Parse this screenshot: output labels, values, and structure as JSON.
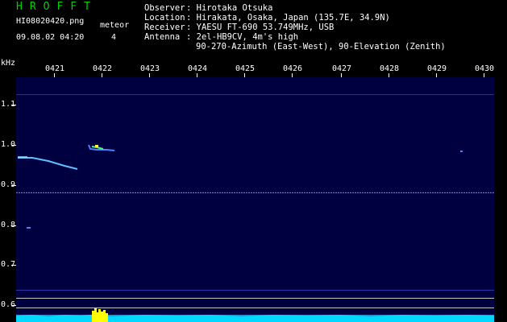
{
  "app_title": "HROFFT",
  "file_name": "HI08020420.png",
  "type_label": "meteor",
  "timestamp": "09.08.02 04:20",
  "count": "4",
  "station": {
    "observer_key": "Observer",
    "observer": "Hirotaka Otsuka",
    "location_key": "Location",
    "location": "Hirakata, Osaka, Japan (135.7E, 34.9N)",
    "receiver_key": "Receiver",
    "receiver": "YAESU FT-690 53.749MHz, USB",
    "antenna_key": "Antenna",
    "antenna_line1": "2el-HB9CV, 4m's high",
    "antenna_line2": "90-270-Azimuth (East-West), 90-Elevation (Zenith)"
  },
  "y_unit": "kHz",
  "x_ticks": [
    "0421",
    "0422",
    "0423",
    "0424",
    "0425",
    "0426",
    "0427",
    "0428",
    "0429",
    "0430"
  ],
  "y_ticks": [
    "1.1",
    "1.0",
    "0.9",
    "0.8",
    "0.7",
    "0.6"
  ],
  "colors": {
    "title_green": "#00d000",
    "plot_bg": "#000040",
    "carrier_line": "#5078ff",
    "echo": "#60c0ff",
    "noise_floor": "#00d8ff",
    "noise_burst": "#ffff00"
  }
}
